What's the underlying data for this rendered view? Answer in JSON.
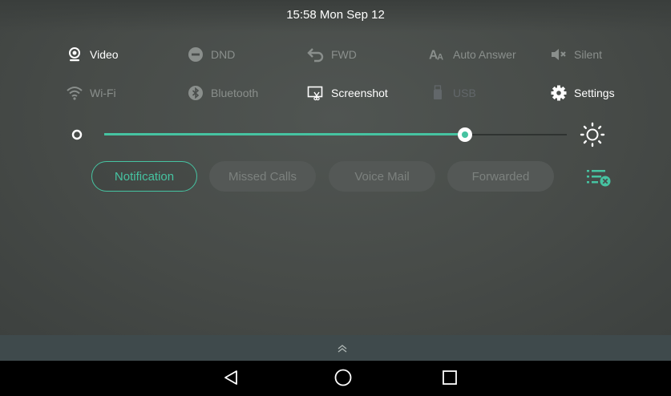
{
  "status_bar": {
    "time_date": "15:58 Mon Sep 12"
  },
  "quick_settings": {
    "row1": [
      {
        "label": "Video",
        "icon": "video-camera-icon",
        "active": true
      },
      {
        "label": "DND",
        "icon": "dnd-icon",
        "active": false
      },
      {
        "label": "FWD",
        "icon": "forward-icon",
        "active": false
      },
      {
        "label": "Auto Answer",
        "icon": "auto-answer-icon",
        "active": false
      },
      {
        "label": "Silent",
        "icon": "speaker-mute-icon",
        "active": false
      }
    ],
    "row2": [
      {
        "label": "Wi-Fi",
        "icon": "wifi-icon",
        "active": false
      },
      {
        "label": "Bluetooth",
        "icon": "bluetooth-icon",
        "active": false
      },
      {
        "label": "Screenshot",
        "icon": "screenshot-icon",
        "active": true
      },
      {
        "label": "USB",
        "icon": "usb-icon",
        "active": false
      },
      {
        "label": "Settings",
        "icon": "gear-icon",
        "active": true
      }
    ]
  },
  "brightness": {
    "level": 0.78
  },
  "notification_tabs": {
    "tabs": [
      {
        "label": "Notification",
        "active": true
      },
      {
        "label": "Missed Calls",
        "active": false
      },
      {
        "label": "Voice Mail",
        "active": false
      },
      {
        "label": "Forwarded",
        "active": false
      }
    ],
    "clear_icon": "clear-all-icon"
  },
  "colors": {
    "accent": "#46c3a1",
    "panel": "#4a4e4c",
    "pull_bar": "#3f4a4c",
    "nav_bar": "#000000"
  },
  "nav_bar": {
    "buttons": [
      "back",
      "home",
      "recents"
    ]
  }
}
